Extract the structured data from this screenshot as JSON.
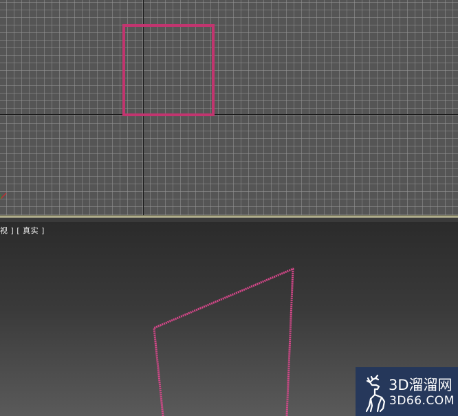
{
  "bottom_viewport": {
    "label_prefix": "视 ] [ ",
    "label_shading": "真实",
    "label_suffix": " ]"
  },
  "watermark": {
    "line1": "3D溜溜网",
    "line2": "3D66.COM"
  },
  "colors": {
    "shape_outline": "#c2356f",
    "shape_outline_perspective": "#d6478a",
    "grid_background": "#555555",
    "viewport_border_active": "#d9d7b4"
  },
  "icons": {
    "axis_gizmo": "axis-gizmo-icon",
    "watermark_logo": "deer-logo-icon"
  }
}
